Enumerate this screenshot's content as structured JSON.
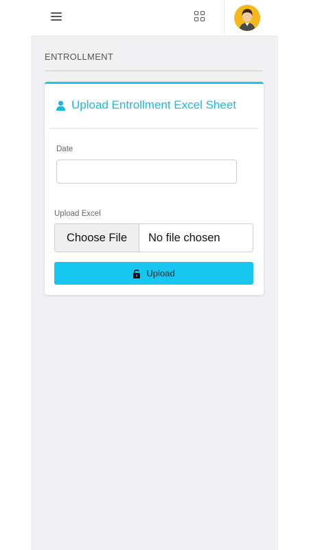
{
  "header": {
    "menu_icon": "hamburger-icon",
    "apps_icon": "grid-icon",
    "avatar_icon": "user-avatar"
  },
  "page": {
    "section_title": "ENTROLLMENT"
  },
  "card": {
    "title": "Upload Entrollment Excel Sheet",
    "title_icon": "user-icon",
    "accent_color": "#1ec4ea",
    "date_label": "Date",
    "date_value": "",
    "upload_label": "Upload Excel",
    "file_button_label": "Choose File",
    "file_status": "No file chosen",
    "upload_button_label": "Upload",
    "upload_button_icon": "lock-open-icon",
    "upload_button_color": "#16c6ef"
  }
}
